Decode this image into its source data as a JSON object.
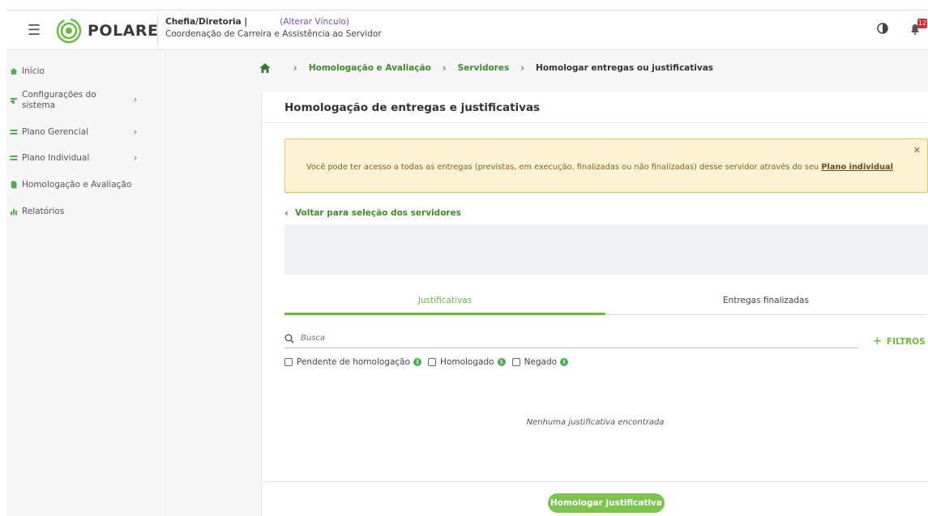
{
  "header": {
    "app_name": "POLARE",
    "role": "Chefia/Diretoria |",
    "change_link": "(Alterar Vínculo)",
    "unit": "Coordenação de Carreira e Assistência ao Servidor",
    "notification_count": "12"
  },
  "sidebar": {
    "items": [
      {
        "label": "Início"
      },
      {
        "label": "Configurações do sistema",
        "line1": "Configurações do",
        "line2": "sistema"
      },
      {
        "label": "Plano Gerencial"
      },
      {
        "label": "Plano Individual"
      },
      {
        "label": "Homologação e Avaliação"
      },
      {
        "label": "Relatórios"
      }
    ]
  },
  "breadcrumb": {
    "items": [
      "Homologação e Avaliação",
      "Servidores",
      "Homologar entregas ou justificativas"
    ]
  },
  "page": {
    "title": "Homologação de entregas e justificativas",
    "alert_text": "Você pode ter acesso a todas as entregas (previstas, em execução, finalizadas ou não finalizadas) desse servidor através do seu ",
    "alert_link": "Plano individual",
    "back_link": "Voltar para seleção dos servidores",
    "tabs": [
      {
        "label": "Justificativas",
        "active": true
      },
      {
        "label": "Entregas finalizadas",
        "active": false
      }
    ],
    "search_placeholder": "Busca",
    "filters_label": "FILTROS",
    "checkboxes": [
      {
        "label": "Pendente de homologação"
      },
      {
        "label": "Homologado"
      },
      {
        "label": "Negado"
      }
    ],
    "empty_message": "Nenhuma justificativa encontrada",
    "primary_button": "Homologar justificativa"
  },
  "colors": {
    "accent_green": "#6aba3e",
    "link_green": "#3d8b2b",
    "alert_bg": "#fdf3d4",
    "alert_border": "#e6c65c",
    "badge_red": "#d32f2f"
  }
}
